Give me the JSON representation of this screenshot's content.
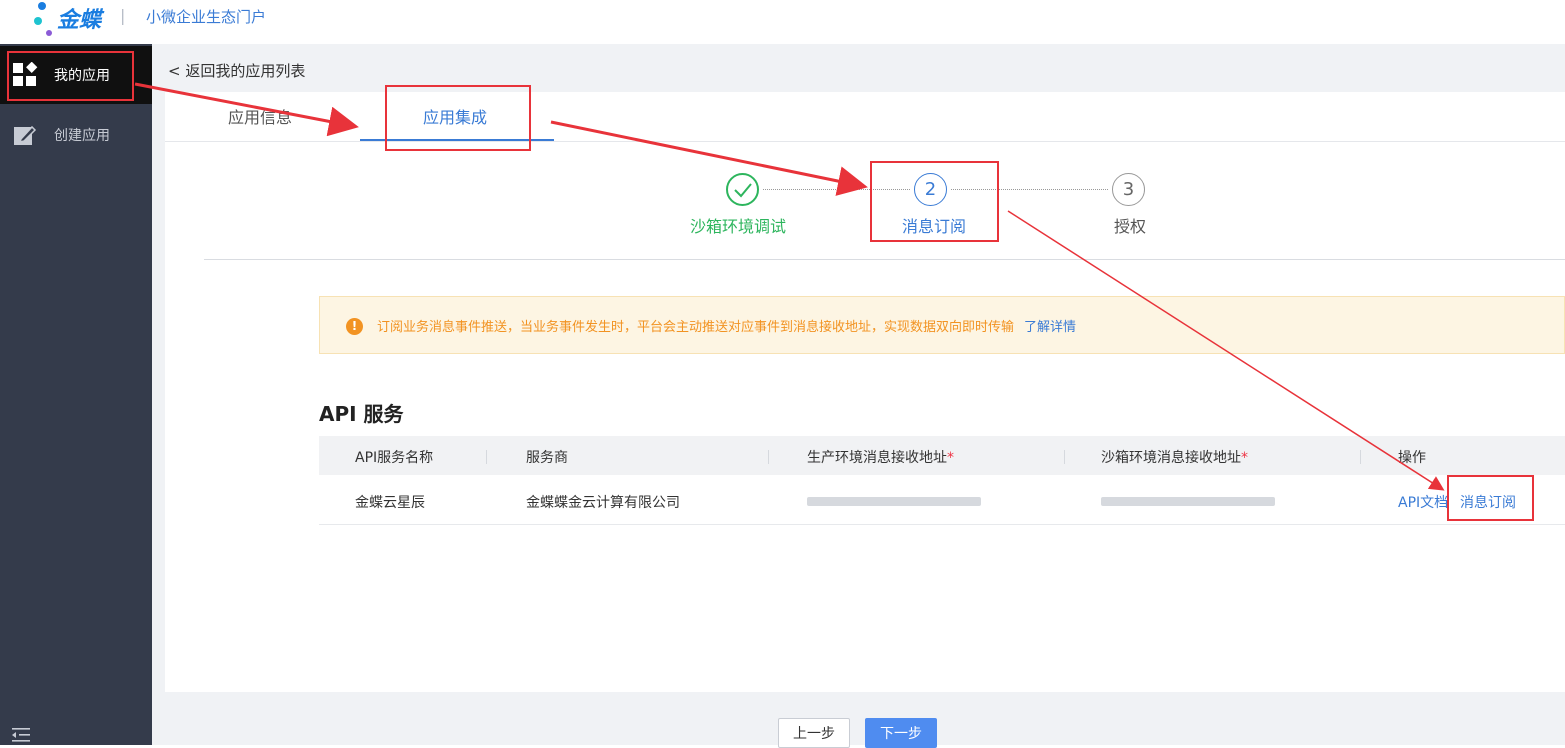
{
  "brand": {
    "name": "金蝶",
    "separator": "|",
    "subtitle": "小微企业生态门户"
  },
  "sidebar": {
    "items": [
      {
        "label": "我的应用",
        "icon": "apps-grid-icon",
        "active": true
      },
      {
        "label": "创建应用",
        "icon": "edit-icon",
        "active": false
      }
    ],
    "collapse_icon": "collapse-menu-icon"
  },
  "main": {
    "back_link": "< 返回我的应用列表",
    "tabs": [
      {
        "label": "应用信息",
        "active": false
      },
      {
        "label": "应用集成",
        "active": true
      }
    ],
    "steps": [
      {
        "number": "",
        "label": "沙箱环境调试",
        "state": "done"
      },
      {
        "number": "2",
        "label": "消息订阅",
        "state": "current"
      },
      {
        "number": "3",
        "label": "授权",
        "state": "pending"
      }
    ],
    "notice": {
      "icon": "!",
      "text": "订阅业务消息事件推送，当业务事件发生时，平台会主动推送对应事件到消息接收地址，实现数据双向即时传输",
      "link": "了解详情"
    },
    "section_title": "API 服务",
    "table": {
      "headers": [
        "API服务名称",
        "服务商",
        "生产环境消息接收地址",
        "沙箱环境消息接收地址",
        "操作"
      ],
      "required_mark": "*",
      "rows": [
        {
          "name": "金蝶云星辰",
          "provider": "金蝶蝶金云计算有限公司",
          "prod_url": "",
          "sandbox_url": "",
          "actions": [
            "API文档",
            "消息订阅"
          ]
        }
      ]
    },
    "buttons": {
      "prev": "上一步",
      "next": "下一步"
    }
  },
  "colors": {
    "primary": "#3a7bd5",
    "success": "#2db55d",
    "warning": "#f29322",
    "sidebar_bg": "#343b4b",
    "annotation": "#e8333a"
  }
}
